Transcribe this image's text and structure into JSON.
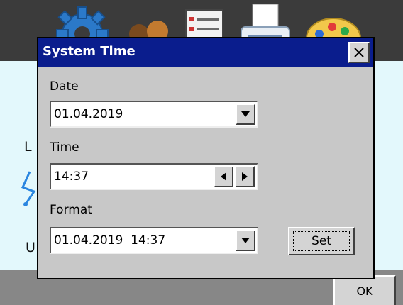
{
  "dialog": {
    "title": "System Time",
    "date_label": "Date",
    "date_value": "01.04.2019",
    "time_label": "Time",
    "time_value": "14:37",
    "format_label": "Format",
    "format_value": "01.04.2019  14:37",
    "set_label": "Set"
  },
  "background": {
    "letter_l": "L",
    "letter_u": "U"
  },
  "footer": {
    "ok_label": "OK"
  },
  "colors": {
    "titlebar": "#0a1d8d",
    "topbar": "#3b3b3b",
    "bottombar": "#878787",
    "dialog_face": "#c8c8c8",
    "content_bg": "#e3f8fc"
  },
  "icons": [
    "gear-icon",
    "users-icon",
    "list-icon",
    "printer-icon",
    "palette-icon"
  ]
}
